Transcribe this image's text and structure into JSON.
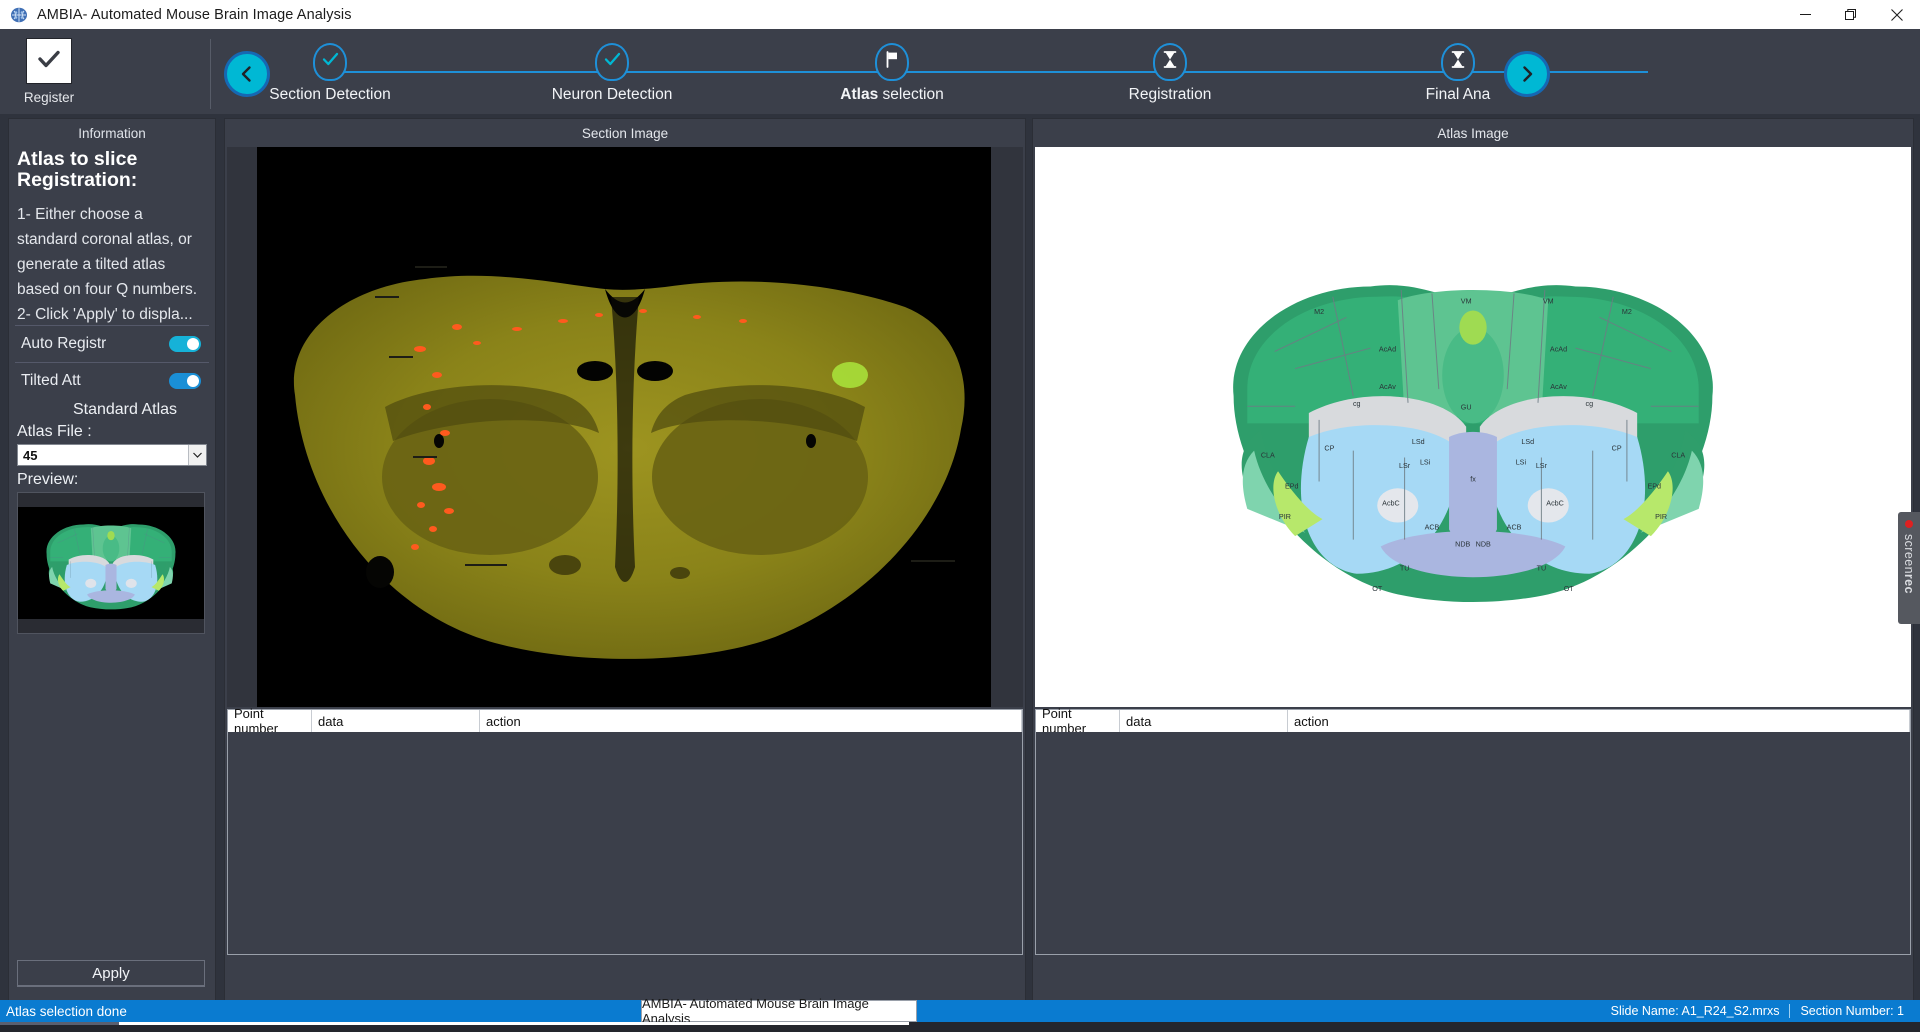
{
  "window": {
    "title": "AMBIA- Automated Mouse Brain Image Analysis",
    "app_icon": "brain-icon",
    "minimize_label": "—",
    "maximize_label": "❐",
    "close_label": "✕"
  },
  "toolbar": {
    "register_button_label": "Register",
    "register_icon": "checkmark-icon",
    "prev_icon": "chevron-left-icon",
    "next_icon": "chevron-right-icon"
  },
  "stepper": {
    "steps": [
      {
        "label": "Section Detection",
        "label_bold": "",
        "icon": "check-icon",
        "state": "done"
      },
      {
        "label": "Neuron Detection",
        "label_bold": "",
        "icon": "check-icon",
        "state": "done"
      },
      {
        "label": " selection",
        "label_bold": "Atlas",
        "icon": "flag-icon",
        "state": "current"
      },
      {
        "label": "Registration",
        "label_bold": "",
        "icon": "hourglass-icon",
        "state": "pending"
      },
      {
        "label": "Final Ana",
        "label_bold": "",
        "icon": "hourglass-icon",
        "state": "pending"
      }
    ]
  },
  "sidebar": {
    "panel_title": "Information",
    "heading": "Atlas to slice\nRegistration:",
    "body_text": "1- Either choose a standard coronal atlas, or generate a tilted atlas based on four Q numbers.\n2- Click 'Apply' to displa...",
    "auto_register": {
      "label": "Auto Registr",
      "on": true
    },
    "tilted_atlas": {
      "label": "Tilted Att",
      "on": true
    },
    "standard_atlas_label": "Standard Atlas",
    "atlas_file_label": "Atlas File :",
    "atlas_file_value": "45",
    "atlas_file_options": [
      "45"
    ],
    "preview_label": "Preview:",
    "apply_label": "Apply"
  },
  "section_panel": {
    "title": "Section Image",
    "table": {
      "columns": [
        "Point number",
        "data",
        "action"
      ],
      "rows": []
    }
  },
  "atlas_panel": {
    "title": "Atlas Image",
    "table": {
      "columns": [
        "Point number",
        "data",
        "action"
      ],
      "rows": []
    }
  },
  "statusbar": {
    "message": "Atlas selection done",
    "slide_name": "Slide Name: A1_R24_S2.mrxs",
    "section_number": "Section Number: 1",
    "taskbar_button": "AMBIA- Automated Mouse Brain Image Analysis"
  },
  "watermark": {
    "text_a": "screen",
    "text_b": "rec"
  },
  "colors": {
    "accent_blue": "#1e90d8",
    "accent_cyan": "#00b8d4",
    "status_blue": "#0a7bd0",
    "panel_bg": "#3b3f4a"
  }
}
